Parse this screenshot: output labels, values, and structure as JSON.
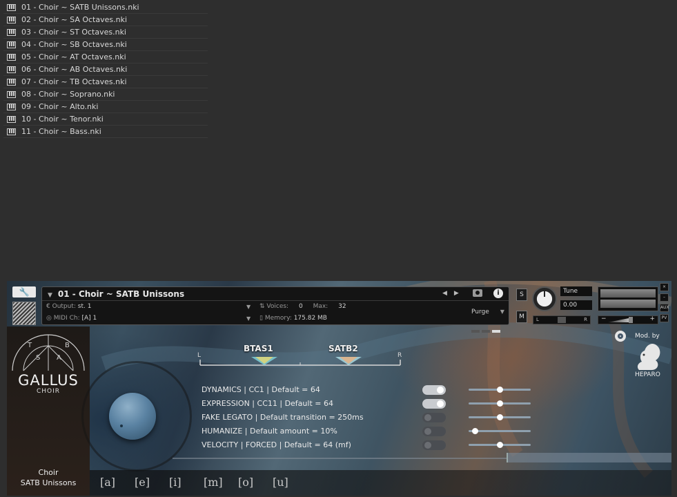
{
  "file_list": [
    "01 - Choir ~ SATB Unissons.nki",
    "02 - Choir ~ SA Octaves.nki",
    "03 - Choir ~ ST Octaves.nki",
    "04 - Choir ~ SB Octaves.nki",
    "05 - Choir ~ AT Octaves.nki",
    "06 - Choir ~ AB Octaves.nki",
    "07 - Choir ~ TB Octaves.nki",
    "08 - Choir ~ Soprano.nki",
    "09 - Choir ~ Alto.nki",
    "10 - Choir ~ Tenor.nki",
    "11 - Choir ~ Bass.nki"
  ],
  "header": {
    "instrument_name": "01 - Choir ~ SATB Unissons",
    "output_label": "Output:",
    "output_value": "st. 1",
    "midi_label": "MIDI Ch:",
    "midi_value": "[A]  1",
    "voices_label": "Voices:",
    "voices_value": "0",
    "max_label": "Max:",
    "max_value": "32",
    "memory_label": "Memory:",
    "memory_value": "175.82 MB",
    "purge_label": "Purge",
    "solo_label": "S",
    "mute_label": "M",
    "tune_label": "Tune",
    "tune_value": "0.00",
    "pan_left": "L",
    "pan_right": "R",
    "vol_minus": "−",
    "vol_plus": "+",
    "side_close": "×",
    "side_min": "–",
    "side_aux": "AUX",
    "side_pv": "PV"
  },
  "brand": {
    "logo_letters": [
      "T",
      "B",
      "S",
      "A"
    ],
    "title": "GALLUS",
    "subtitle": "CHOIR",
    "patch_line1": "Choir",
    "patch_line2": "SATB Unissons"
  },
  "mod": {
    "mod_by": "Mod. by",
    "author": "HEPARO"
  },
  "pan_scale": {
    "left": "L",
    "right": "R",
    "group1": "BTAS1",
    "group2": "SATB2"
  },
  "controls": [
    {
      "label": "DYNAMICS | CC1 | Default = 64",
      "enabled": true,
      "value": 0.5
    },
    {
      "label": "EXPRESSION | CC11 | Default = 64",
      "enabled": true,
      "value": 0.5
    },
    {
      "label": "FAKE LEGATO | Default transition = 250ms",
      "enabled": false,
      "value": 0.5
    },
    {
      "label": "HUMANIZE | Default amount = 10%",
      "enabled": false,
      "value": 0.1
    },
    {
      "label": "VELOCITY | FORCED | Default = 64 (mf)",
      "enabled": false,
      "value": 0.5
    }
  ],
  "vowels": [
    "[a]",
    "[e]",
    "[i]",
    "[m]",
    "[o]",
    "[u]"
  ],
  "colors": {
    "background": "#2e2e2e",
    "toggle_on": "#c9ccd0",
    "toggle_off": "#4a4d52",
    "knob_blue": "#5a82a2"
  }
}
